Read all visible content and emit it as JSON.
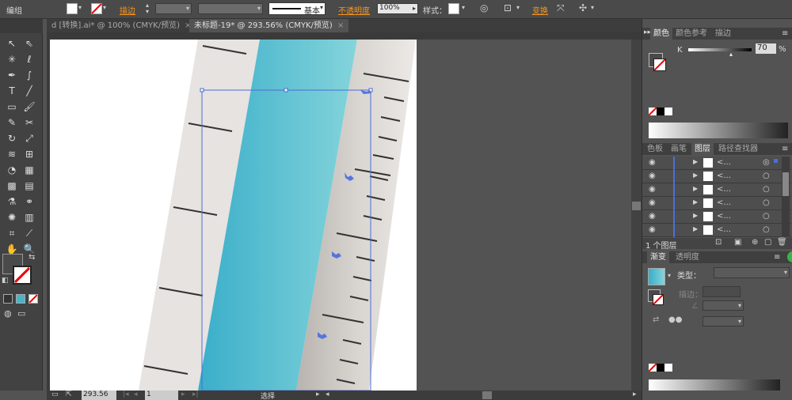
{
  "selection_label": "编组",
  "toolbar": {
    "stroke_label": "描边",
    "stroke_style": "基本",
    "opacity_label": "不透明度",
    "opacity_value": "100%",
    "style_label": "样式：",
    "transform_label": "变换"
  },
  "tabs": [
    {
      "label": "d [转换].ai* @ 100% (CMYK/预览)",
      "active": false
    },
    {
      "label": "未标题-19* @ 293.56% (CMYK/预览)",
      "active": true
    }
  ],
  "tab_close": "×",
  "status": {
    "zoom": "293.56",
    "artboard_num": "1",
    "tool_label": "选择"
  },
  "color_panel": {
    "tabs": [
      "颜色",
      "颜色参考",
      "描边"
    ],
    "channel": "K",
    "value": "70",
    "unit": "%"
  },
  "layers_panel": {
    "tabs": [
      "色板",
      "画笔",
      "图层",
      "路径查找器"
    ],
    "rows": [
      "<...",
      "<...",
      "<...",
      "<...",
      "<...",
      "<..."
    ],
    "count_label": "1 个图层"
  },
  "gradient_panel": {
    "tabs": [
      "渐变",
      "透明度"
    ],
    "type_label": "类型：",
    "stroke_label": "描边："
  },
  "colors": {
    "blue_light": "#84d4db",
    "blue_dark": "#3aaec9",
    "ruler_body": "#e6e3e1",
    "ruler_shade": "#c9c4c0",
    "accent": "#f7941d"
  }
}
